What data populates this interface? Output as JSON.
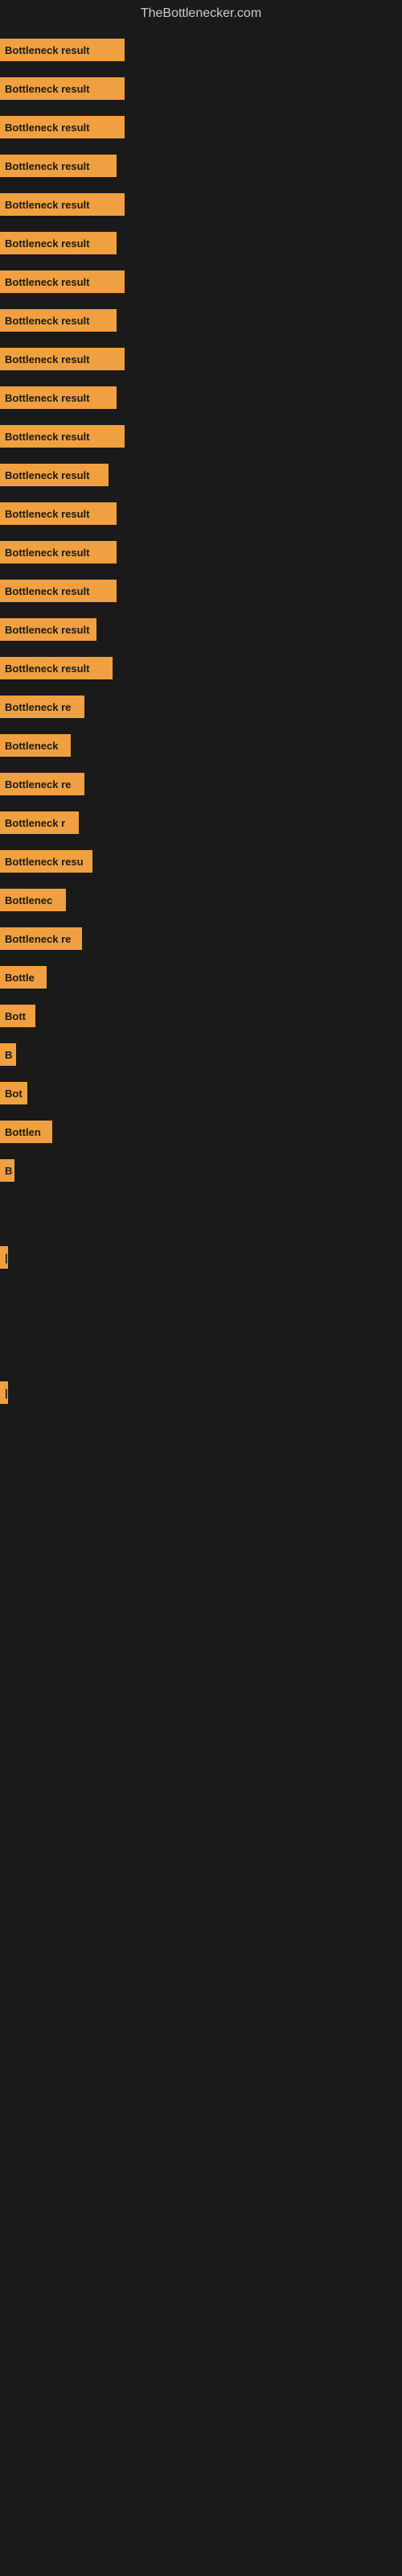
{
  "site": {
    "title": "TheBottlenecker.com"
  },
  "bars": [
    {
      "label": "Bottleneck result",
      "width": 155
    },
    {
      "label": "Bottleneck result",
      "width": 155
    },
    {
      "label": "Bottleneck result",
      "width": 155
    },
    {
      "label": "Bottleneck result",
      "width": 145
    },
    {
      "label": "Bottleneck result",
      "width": 155
    },
    {
      "label": "Bottleneck result",
      "width": 145
    },
    {
      "label": "Bottleneck result",
      "width": 155
    },
    {
      "label": "Bottleneck result",
      "width": 145
    },
    {
      "label": "Bottleneck result",
      "width": 155
    },
    {
      "label": "Bottleneck result",
      "width": 145
    },
    {
      "label": "Bottleneck result",
      "width": 155
    },
    {
      "label": "Bottleneck result",
      "width": 135
    },
    {
      "label": "Bottleneck result",
      "width": 145
    },
    {
      "label": "Bottleneck result",
      "width": 145
    },
    {
      "label": "Bottleneck result",
      "width": 145
    },
    {
      "label": "Bottleneck result",
      "width": 120
    },
    {
      "label": "Bottleneck result",
      "width": 140
    },
    {
      "label": "Bottleneck re",
      "width": 105
    },
    {
      "label": "Bottleneck",
      "width": 88
    },
    {
      "label": "Bottleneck re",
      "width": 105
    },
    {
      "label": "Bottleneck r",
      "width": 98
    },
    {
      "label": "Bottleneck resu",
      "width": 115
    },
    {
      "label": "Bottlenec",
      "width": 82
    },
    {
      "label": "Bottleneck re",
      "width": 102
    },
    {
      "label": "Bottle",
      "width": 58
    },
    {
      "label": "Bott",
      "width": 44
    },
    {
      "label": "B",
      "width": 20
    },
    {
      "label": "Bot",
      "width": 34
    },
    {
      "label": "Bottlen",
      "width": 65
    },
    {
      "label": "B",
      "width": 18
    },
    {
      "label": "",
      "width": 0
    },
    {
      "label": "",
      "width": 0
    },
    {
      "label": "|",
      "width": 10
    },
    {
      "label": "",
      "width": 0
    },
    {
      "label": "",
      "width": 0
    },
    {
      "label": "",
      "width": 0
    },
    {
      "label": "",
      "width": 0
    },
    {
      "label": "|",
      "width": 10
    }
  ]
}
